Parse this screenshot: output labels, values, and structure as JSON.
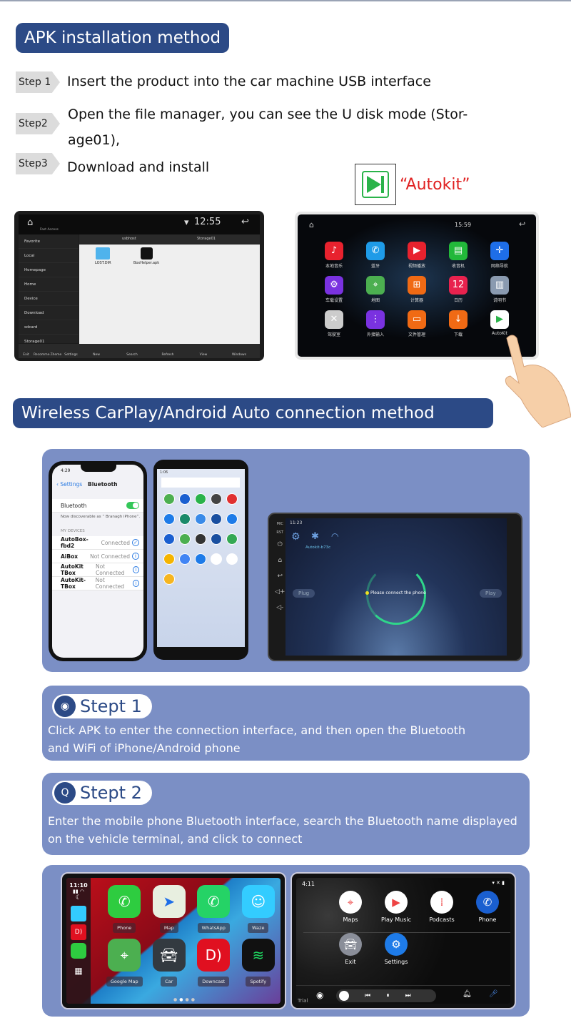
{
  "colors": {
    "header": "#2c4a86",
    "panel": "#7b8fc5",
    "autokit_label": "#e02020",
    "connect_ring": "#2fd68a"
  },
  "apk": {
    "title": "APK installation method",
    "steps": [
      {
        "label": "Step 1",
        "text": "Insert the product into the car machine USB interface"
      },
      {
        "label": "Step2",
        "text": "Open the file manager, you can see the U disk mode (Stor-",
        "text2": "age01),"
      },
      {
        "label": "Step3",
        "text": "Download and install"
      }
    ],
    "autokit_label": "“Autokit”"
  },
  "file_manager": {
    "time": "12:55",
    "quick_access": "Fast Access",
    "path": [
      "usbhost",
      "Storage01"
    ],
    "sidebar": [
      "Favorite",
      "Local",
      "Homepage",
      "Home",
      "Device",
      "Download",
      "sdcard",
      "Storage01"
    ],
    "files": [
      {
        "name": "LOST.DIR",
        "icon": "folder-icon"
      },
      {
        "name": "BoxHelper.apk",
        "icon": "apk-icon"
      }
    ],
    "bottom_left": [
      "Exit",
      "Recomme...",
      "Theme",
      "Settings"
    ],
    "bottom_right": [
      "New",
      "Search",
      "Refresh",
      "View",
      "Windows"
    ]
  },
  "car_home": {
    "time": "15:59",
    "apps": [
      {
        "label": "本地音乐",
        "icon": "music-icon",
        "color": "#e8222e"
      },
      {
        "label": "蓝牙",
        "icon": "phone-icon",
        "color": "#1e9be8"
      },
      {
        "label": "视频播放",
        "icon": "video-icon",
        "color": "#e8222e"
      },
      {
        "label": "收音机",
        "icon": "radio-icon",
        "color": "#22b83a"
      },
      {
        "label": "网络导航",
        "icon": "navigation-icon",
        "color": "#1e6ee8"
      },
      {
        "label": "车载设置",
        "icon": "settings-icon",
        "color": "#7a32e0"
      },
      {
        "label": "地图",
        "icon": "maps-icon",
        "color": "#4caf50"
      },
      {
        "label": "计算器",
        "icon": "calculator-icon",
        "color": "#f06a14"
      },
      {
        "label": "日历",
        "icon": "calendar-icon",
        "color": "#e8224e"
      },
      {
        "label": "说明书",
        "icon": "manual-icon",
        "color": "#8a9ab0"
      },
      {
        "label": "驾驶室",
        "icon": "dvr-icon",
        "color": "#cccccc"
      },
      {
        "label": "外接输入",
        "icon": "input-icon",
        "color": "#7a32e0"
      },
      {
        "label": "文件管理",
        "icon": "folder-icon",
        "color": "#f06a14"
      },
      {
        "label": "下载",
        "icon": "download-icon",
        "color": "#f06a14"
      },
      {
        "label": "AutoKit",
        "icon": "autokit-icon",
        "color": "#ffffff"
      }
    ]
  },
  "wireless": {
    "title": "Wireless CarPlay/Android Auto connection method",
    "iphone": {
      "time": "4:29",
      "back": "Settings",
      "title": "Bluetooth",
      "toggle_label": "Bluetooth",
      "bluetooth_on": true,
      "discoverable": "Now discoverable as “ Branagh iPhone”.",
      "section": "MY DEVICES",
      "devices": [
        {
          "name": "AutoBox-fbd2",
          "status": "Connected"
        },
        {
          "name": "AiBox",
          "status": "Not Connected"
        },
        {
          "name": "AutoKit TBox",
          "status": "Not Connected"
        },
        {
          "name": "AutoKit-TBox",
          "status": "Not Connected"
        }
      ]
    },
    "android": {
      "time": "1:06"
    },
    "head_unit": {
      "time": "11:23",
      "device_name": "Autokit-b73c",
      "message": "Please connect the phone",
      "plug": "Plug",
      "play": "Play",
      "side_buttons": [
        "MIC",
        "RST"
      ]
    },
    "steps": [
      {
        "title": "Stept 1",
        "text": "Click APK to enter the connection interface, and then open the Bluetooth",
        "text2": "and WiFi of iPhone/Android phone"
      },
      {
        "title": "Stept 2",
        "text": "Enter the mobile phone Bluetooth interface, search the Bluetooth name displayed",
        "text2": "on the vehicle terminal, and click to connect"
      }
    ]
  },
  "carplay": {
    "time": "11:10",
    "apps": [
      {
        "label": "Phone",
        "icon": "phone-icon",
        "color": "#2ecc40"
      },
      {
        "label": "Map",
        "icon": "apple-maps-icon",
        "color": "#e8efe0"
      },
      {
        "label": "WhatsApp",
        "icon": "whatsapp-icon",
        "color": "#25d366"
      },
      {
        "label": "Waze",
        "icon": "waze-icon",
        "color": "#33ccff"
      },
      {
        "label": "Google Map",
        "icon": "google-maps-icon",
        "color": "#4caf50"
      },
      {
        "label": "Car",
        "icon": "car-icon",
        "color": "#333a40"
      },
      {
        "label": "Downcast",
        "icon": "downcast-icon",
        "color": "#e01020"
      },
      {
        "label": "Spotify",
        "icon": "spotify-icon",
        "color": "#111111"
      }
    ]
  },
  "android_auto": {
    "time": "4:11",
    "trial": "Trial",
    "apps": [
      {
        "label": "Maps",
        "icon": "google-maps-icon",
        "color": "#ffffff"
      },
      {
        "label": "Play Music",
        "icon": "play-music-icon",
        "color": "#ffffff"
      },
      {
        "label": "Podcasts",
        "icon": "podcasts-icon",
        "color": "#ffffff"
      },
      {
        "label": "Phone",
        "icon": "phone-icon",
        "color": "#1a5fd0"
      },
      {
        "label": "Exit",
        "icon": "car-icon",
        "color": "#8a8e99"
      },
      {
        "label": "Settings",
        "icon": "settings-icon",
        "color": "#1e7be8"
      }
    ]
  }
}
